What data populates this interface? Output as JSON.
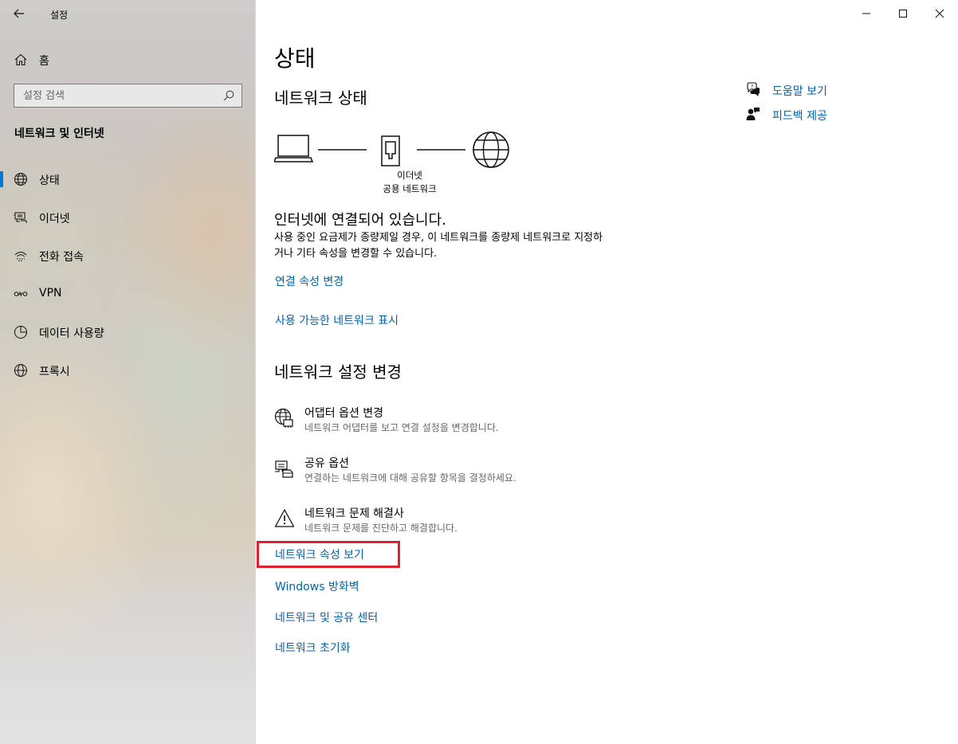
{
  "app": {
    "title": "설정"
  },
  "sidebar": {
    "home_label": "홈",
    "search_placeholder": "설정 검색",
    "section_title": "네트워크 및 인터넷",
    "items": [
      {
        "label": "상태",
        "icon": "globe-status-icon",
        "active": true
      },
      {
        "label": "이더넷",
        "icon": "ethernet-icon",
        "active": false
      },
      {
        "label": "전화 접속",
        "icon": "dial-up-icon",
        "active": false
      },
      {
        "label": "VPN",
        "icon": "vpn-icon",
        "active": false
      },
      {
        "label": "데이터 사용량",
        "icon": "data-usage-icon",
        "active": false
      },
      {
        "label": "프록시",
        "icon": "globe-icon",
        "active": false
      }
    ]
  },
  "main": {
    "title": "상태",
    "network_status_heading": "네트워크 상태",
    "diagram": {
      "connection_type": "이더넷",
      "network_profile": "공용 네트워크"
    },
    "status_heading": "인터넷에 연결되어 있습니다.",
    "status_description": "사용 중인 요금제가 종량제일 경우, 이 네트워크를 종량제 네트워크로 지정하거나 기타 속성을 변경할 수 있습니다.",
    "link_change_properties": "연결 속성 변경",
    "link_show_networks": "사용 가능한 네트워크 표시",
    "change_settings_heading": "네트워크 설정 변경",
    "options": [
      {
        "title": "어댑터 옵션 변경",
        "description": "네트워크 어댑터를 보고 연결 설정을 변경합니다.",
        "icon": "adapter-icon"
      },
      {
        "title": "공유 옵션",
        "description": "연결하는 네트워크에 대해 공유할 항목을 결정하세요.",
        "icon": "sharing-icon"
      },
      {
        "title": "네트워크 문제 해결사",
        "description": "네트워크 문제를 진단하고 해결합니다.",
        "icon": "warning-icon"
      }
    ],
    "links": [
      "네트워크 속성 보기",
      "Windows 방화벽",
      "네트워크 및 공유 센터",
      "네트워크 초기화"
    ]
  },
  "help": {
    "get_help": "도움말 보기",
    "give_feedback": "피드백 제공"
  },
  "colors": {
    "accent": "#0078d7",
    "link": "#0063b1",
    "highlight": "#e0202f"
  }
}
